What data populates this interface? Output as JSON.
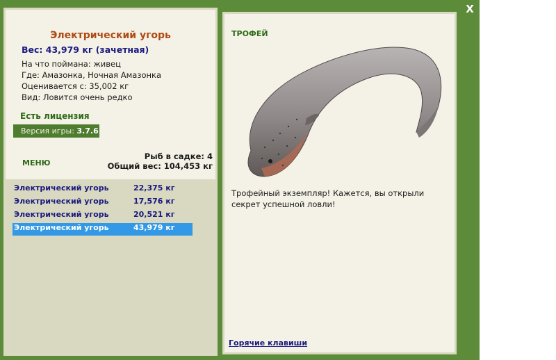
{
  "window": {
    "close_label": "X"
  },
  "fish": {
    "name": "Электрический угорь",
    "weight_line": "Вес: 43,979 кг (зачетная)",
    "bait": "На что поймана: живец",
    "location": "Где: Амазонка, Ночная Амазонка",
    "valued": "Оценивается с: 35,002 кг",
    "rarity": "Вид: Ловится очень редко"
  },
  "license": "Есть лицензия",
  "version": {
    "label": "Версия игры: ",
    "value": "3.7.6"
  },
  "menu_label": "МЕНЮ",
  "keepnet": {
    "count_line": "Рыб в садке: 4",
    "total_line": "Общий вес: 104,453 кг"
  },
  "catches": [
    {
      "name": "Электрический угорь",
      "weight": "22,375 кг",
      "selected": false
    },
    {
      "name": "Электрический угорь",
      "weight": "17,576 кг",
      "selected": false
    },
    {
      "name": "Электрический угорь",
      "weight": "20,521 кг",
      "selected": false
    },
    {
      "name": "Электрический угорь",
      "weight": "43,979 кг",
      "selected": true
    }
  ],
  "trophy": {
    "label": "ТРОФЕЙ",
    "text": "Трофейный экземпляр! Кажется, вы открыли секрет успешной ловли!"
  },
  "hotkeys_label": "Горячие клавиши",
  "colors": {
    "frame": "#5c8b3a",
    "panel": "#f4f2e6",
    "list_bg": "#d9d8c0",
    "title": "#b04a13",
    "selected_row": "#3399e6"
  }
}
